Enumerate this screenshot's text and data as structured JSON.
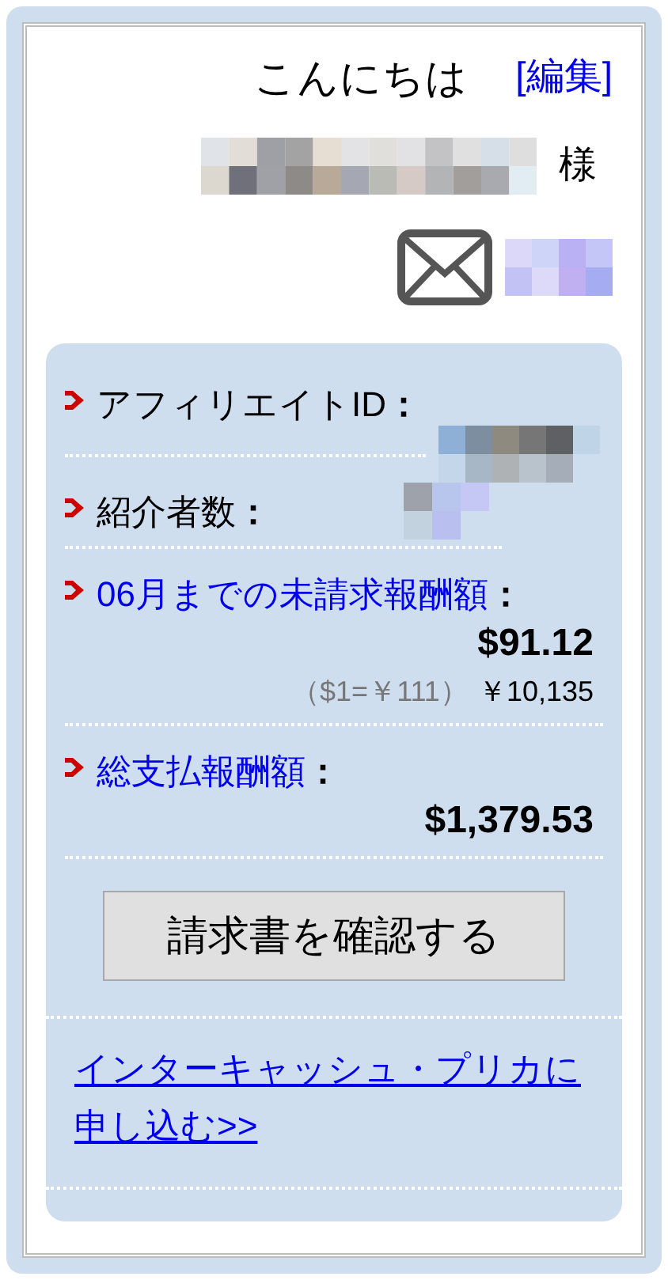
{
  "greeting": {
    "text": "こんにちは",
    "edit_link": "[編集]"
  },
  "user": {
    "suffix": "様"
  },
  "stats": [
    {
      "kind": "masked",
      "label": "アフィリエイトID",
      "colon": "：",
      "link": false
    },
    {
      "kind": "masked",
      "label": "紹介者数",
      "colon": "：",
      "link": false
    },
    {
      "kind": "amount",
      "label": "06月までの未請求報酬額",
      "colon": "：",
      "link": true,
      "amount": "$91.12",
      "rate": "（$1=￥111）",
      "yen": "￥10,135"
    },
    {
      "kind": "amount",
      "label": "総支払報酬額",
      "colon": "：",
      "link": true,
      "amount": "$1,379.53"
    }
  ],
  "invoice_button": "請求書を確認する",
  "apply_link": "インターキャッシュ・プリカに申し込む>>"
}
